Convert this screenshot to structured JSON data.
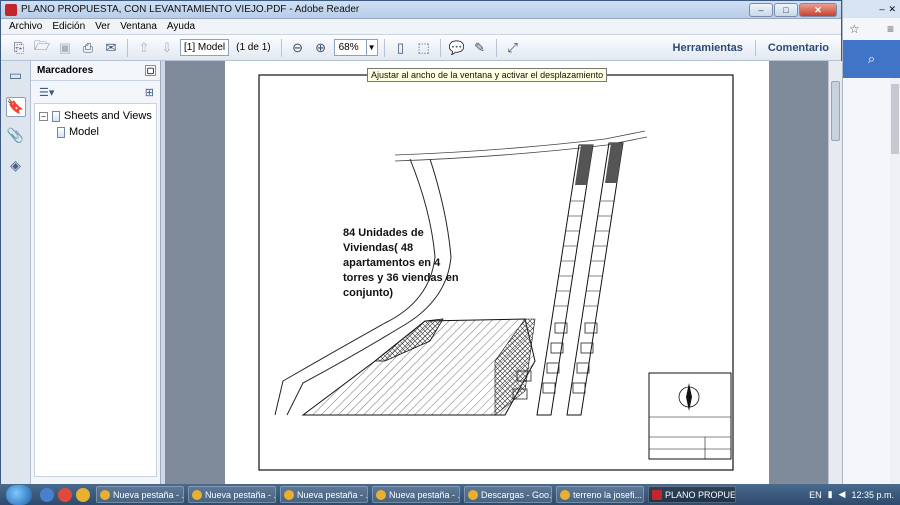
{
  "window": {
    "title": "PLANO PROPUESTA, CON LEVANTAMIENTO VIEJO.PDF - Adobe Reader",
    "min": "–",
    "max": "□",
    "close": "✕"
  },
  "menu": [
    "Archivo",
    "Edición",
    "Ver",
    "Ventana",
    "Ayuda"
  ],
  "toolbar": {
    "page_label": "[1] Model",
    "page_count": "(1 de 1)",
    "zoom": "68%",
    "tools_link": "Herramientas",
    "comment_link": "Comentario"
  },
  "bookmarks": {
    "title": "Marcadores",
    "items": [
      {
        "label": "Sheets and Views"
      },
      {
        "label": "Model"
      }
    ]
  },
  "tooltip": "Ajustar al ancho de la ventana y activar el desplazamiento",
  "document": {
    "annotation": "84 Unidades de Viviendas( 48 apartamentos en 4 torres y 36 viendas en conjunto)"
  },
  "taskbar": {
    "tasks": [
      "Nueva pestaña - ...",
      "Nueva pestaña - ...",
      "Nueva pestaña - ...",
      "Nueva pestaña - ...",
      "Descargas - Goo...",
      "terreno la josefi...",
      "PLANO PROPUE..."
    ],
    "lang": "EN",
    "time": "12:35 p.m."
  },
  "colors": {
    "accent": "#2b4a78",
    "window_border": "#3d5a85",
    "doc_background": "#7f8b9b"
  }
}
